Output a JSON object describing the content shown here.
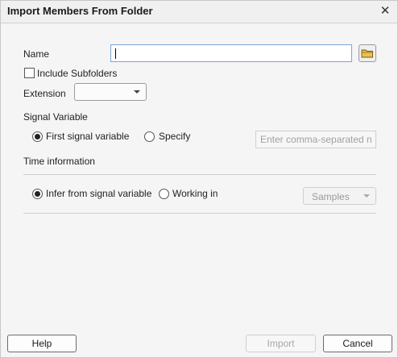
{
  "window": {
    "title": "Import Members From Folder",
    "close_glyph": "✕"
  },
  "form": {
    "name_label": "Name",
    "name_value": "",
    "include_subfolders_label": "Include Subfolders",
    "include_subfolders_checked": false,
    "extension_label": "Extension",
    "extension_value": "",
    "signal_variable_label": "Signal Variable",
    "signal_options": {
      "first": "First signal variable",
      "specify": "Specify",
      "selected": "first"
    },
    "specify_placeholder": "Enter comma-separated n",
    "time_information_label": "Time information",
    "time_options": {
      "infer": "Infer from signal variable",
      "working_in": "Working in",
      "selected": "infer"
    },
    "units_value": "Samples"
  },
  "buttons": {
    "help": "Help",
    "import": "Import",
    "cancel": "Cancel"
  },
  "icons": {
    "folder": "folder-icon",
    "close": "close-icon"
  },
  "colors": {
    "focus_border": "#7aa7d6",
    "folder_yellow": "#e9c24a"
  }
}
